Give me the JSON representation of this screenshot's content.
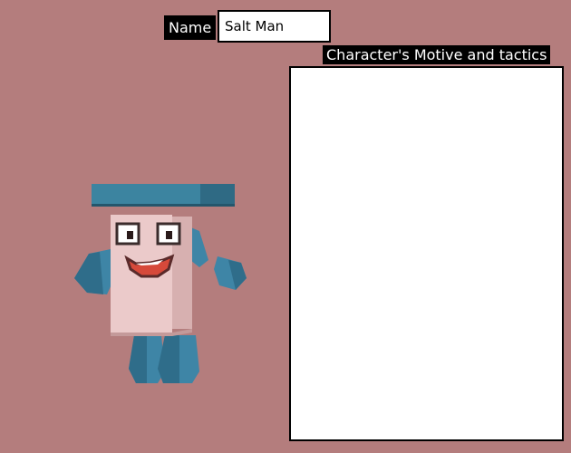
{
  "name_label": "Name",
  "name_value": "Salt Man",
  "motive_label": "Character's Motive and tactics",
  "motive_value": "",
  "character": {
    "icon": "salt-shaker-character-icon",
    "colors": {
      "background": "#b47d7d",
      "body": "#e9c8c8",
      "cap": "#3c84a0",
      "limbs": "#3e85a6",
      "mouth": "#d6493a"
    }
  }
}
